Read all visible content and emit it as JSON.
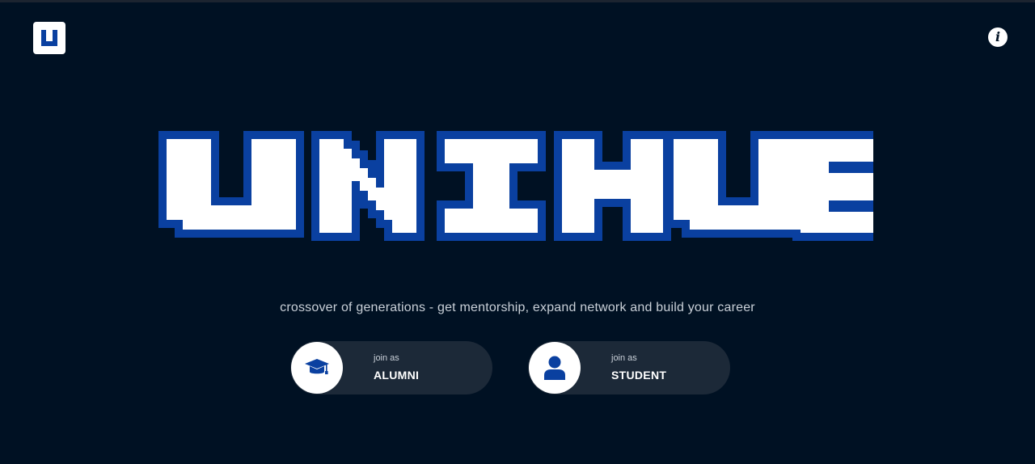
{
  "header": {
    "logo_icon": "unihub-logo-icon",
    "info_icon": "info-icon",
    "info_glyph": "i"
  },
  "hero": {
    "wordmark": "UNIHUB",
    "tagline": "crossover of generations - get mentorship, expand network and build your career"
  },
  "actions": [
    {
      "label_small": "join as",
      "label_main": "ALUMNI",
      "icon": "graduation-cap-icon"
    },
    {
      "label_small": "join as",
      "label_main": "STUDENT",
      "icon": "user-icon"
    }
  ],
  "colors": {
    "background": "#001123",
    "accent": "#0a40a0",
    "button_bg": "#1c2938",
    "text": "#ffffff"
  }
}
